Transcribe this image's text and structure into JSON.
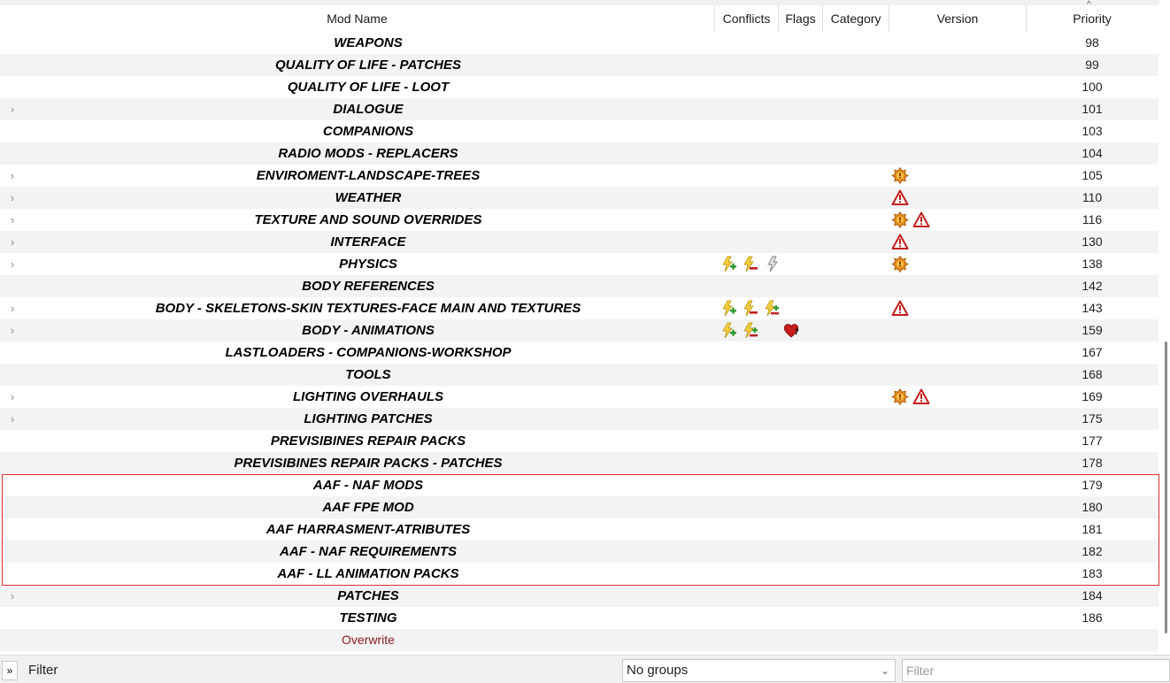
{
  "columns": {
    "mod_name": "Mod Name",
    "conflicts": "Conflicts",
    "flags": "Flags",
    "category": "Category",
    "version": "Version",
    "priority": "Priority"
  },
  "sort_indicator": "^",
  "rows": [
    {
      "expander": "",
      "name": "WEAPONS",
      "priority": "98",
      "conflicts": [],
      "flags": [],
      "version": []
    },
    {
      "expander": "",
      "name": "QUALITY OF LIFE - PATCHES",
      "priority": "99",
      "conflicts": [],
      "flags": [],
      "version": []
    },
    {
      "expander": "",
      "name": "QUALITY OF LIFE - LOOT",
      "priority": "100",
      "conflicts": [],
      "flags": [],
      "version": []
    },
    {
      "expander": ">",
      "name": "DIALOGUE",
      "priority": "101",
      "conflicts": [],
      "flags": [],
      "version": []
    },
    {
      "expander": "",
      "name": "COMPANIONS",
      "priority": "103",
      "conflicts": [],
      "flags": [],
      "version": []
    },
    {
      "expander": "",
      "name": "RADIO MODS - REPLACERS",
      "priority": "104",
      "conflicts": [],
      "flags": [],
      "version": []
    },
    {
      "expander": ">",
      "name": "ENVIROMENT-LANDSCAPE-TREES",
      "priority": "105",
      "conflicts": [],
      "flags": [],
      "version": [
        "gear-warning-icon"
      ]
    },
    {
      "expander": ">",
      "name": "WEATHER",
      "priority": "110",
      "conflicts": [],
      "flags": [],
      "version": [
        "alert-triangle-icon"
      ]
    },
    {
      "expander": ">",
      "name": "TEXTURE AND SOUND OVERRIDES",
      "priority": "116",
      "conflicts": [],
      "flags": [],
      "version": [
        "gear-warning-icon",
        "alert-triangle-icon"
      ]
    },
    {
      "expander": ">",
      "name": "INTERFACE",
      "priority": "130",
      "conflicts": [],
      "flags": [],
      "version": [
        "alert-triangle-icon"
      ]
    },
    {
      "expander": ">",
      "name": "PHYSICS",
      "priority": "138",
      "conflicts": [
        "conflict-overwrite-icon",
        "conflict-overwritten-icon",
        "conflict-redundant-icon"
      ],
      "flags": [],
      "version": [
        "gear-warning-icon"
      ]
    },
    {
      "expander": "",
      "name": "BODY REFERENCES",
      "priority": "142",
      "conflicts": [],
      "flags": [],
      "version": []
    },
    {
      "expander": ">",
      "name": "BODY - SKELETONS-SKIN TEXTURES-FACE MAIN AND TEXTURES",
      "priority": "143",
      "conflicts": [
        "conflict-overwrite-icon",
        "conflict-overwritten-icon",
        "conflict-mixed-icon"
      ],
      "flags": [],
      "version": [
        "alert-triangle-icon"
      ]
    },
    {
      "expander": ">",
      "name": "BODY - ANIMATIONS",
      "priority": "159",
      "conflicts": [
        "conflict-overwrite-icon",
        "conflict-mixed-icon"
      ],
      "flags": [
        "heart-question-icon"
      ],
      "version": []
    },
    {
      "expander": "",
      "name": "LASTLOADERS - COMPANIONS-WORKSHOP",
      "priority": "167",
      "conflicts": [],
      "flags": [],
      "version": []
    },
    {
      "expander": "",
      "name": "TOOLS",
      "priority": "168",
      "conflicts": [],
      "flags": [],
      "version": []
    },
    {
      "expander": ">",
      "name": "LIGHTING OVERHAULS",
      "priority": "169",
      "conflicts": [],
      "flags": [],
      "version": [
        "gear-warning-icon",
        "alert-triangle-icon"
      ]
    },
    {
      "expander": ">",
      "name": "LIGHTING PATCHES",
      "priority": "175",
      "conflicts": [],
      "flags": [],
      "version": []
    },
    {
      "expander": "",
      "name": "PREVISIBINES REPAIR PACKS",
      "priority": "177",
      "conflicts": [],
      "flags": [],
      "version": []
    },
    {
      "expander": "",
      "name": "PREVISIBINES REPAIR PACKS - PATCHES",
      "priority": "178",
      "conflicts": [],
      "flags": [],
      "version": []
    },
    {
      "expander": "",
      "name": "AAF - NAF MODS",
      "priority": "179",
      "conflicts": [],
      "flags": [],
      "version": []
    },
    {
      "expander": "",
      "name": "AAF FPE MOD",
      "priority": "180",
      "conflicts": [],
      "flags": [],
      "version": []
    },
    {
      "expander": "",
      "name": "AAF HARRASMENT-ATRIBUTES",
      "priority": "181",
      "conflicts": [],
      "flags": [],
      "version": []
    },
    {
      "expander": "",
      "name": "AAF - NAF REQUIREMENTS",
      "priority": "182",
      "conflicts": [],
      "flags": [],
      "version": []
    },
    {
      "expander": "",
      "name": "AAF - LL ANIMATION PACKS",
      "priority": "183",
      "conflicts": [],
      "flags": [],
      "version": []
    },
    {
      "expander": ">",
      "name": "PATCHES",
      "priority": "184",
      "conflicts": [],
      "flags": [],
      "version": []
    },
    {
      "expander": "",
      "name": "TESTING",
      "priority": "186",
      "conflicts": [],
      "flags": [],
      "version": []
    },
    {
      "expander": "",
      "name": "Overwrite",
      "priority": "",
      "conflicts": [],
      "flags": [],
      "version": [],
      "overwrite": true
    }
  ],
  "colors": {
    "highlight_border": "#e03030",
    "overwrite_text": "#8b1a1a",
    "alt_row": "#f3f3f3"
  },
  "footer": {
    "collapse_label": "»",
    "filter_label": "Filter",
    "groups_selected": "No groups",
    "filter_placeholder": "Filter"
  }
}
